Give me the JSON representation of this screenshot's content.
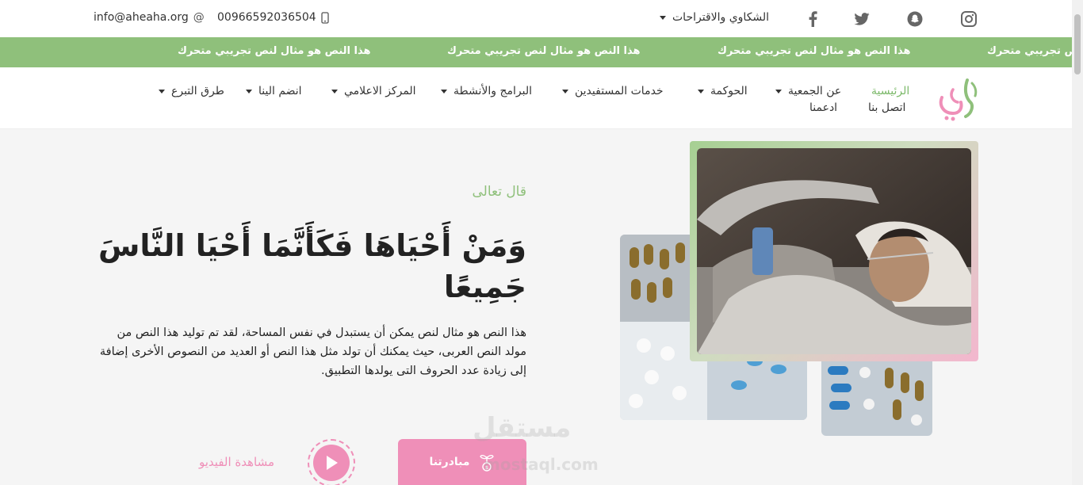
{
  "topbar": {
    "email": "info@aheaha.org",
    "phone": "00966592036504",
    "complaints": "الشكاوي والاقتراحات"
  },
  "marquee": {
    "items": [
      "هذا النص هو مثال لنص تجريبي متحرك",
      "هذا النص هو مثال لنص تجريبي متحرك",
      "هذا النص هو مثال لنص تجريبي متحرك",
      "هذا النص هو مثال لنص تجريبي متحرك"
    ],
    "partial": "ص تجريبي متحرك"
  },
  "nav": {
    "home": "الرئيسية",
    "about": "عن الجمعية",
    "governance": "الحوكمة",
    "beneficiaries": "خدمات المستفيدين",
    "programs": "البرامج والأنشطة",
    "media": "المركز الاعلامي",
    "join": "انضم الينا",
    "donate": "طرق التبرع",
    "contact": "اتصل بنا",
    "support": "ادعمنا"
  },
  "hero": {
    "subtitle": "قال تعالى",
    "title": "وَمَنْ أَحْيَاهَا فَكَأَنَّمَا أَحْيَا النَّاسَ جَمِيعًا",
    "description": "هذا النص هو مثال لنص يمكن أن يستبدل في نفس المساحة، لقد تم توليد هذا النص من مولد النص العربى، حيث يمكنك أن تولد مثل هذا النص أو العديد من النصوص الأخرى إضافة إلى زيادة عدد الحروف التى يولدها التطبيق.",
    "primary_button": "مبادرتنا",
    "video_label": "مشاهدة الفيديو"
  },
  "watermark": {
    "line1": "مستقل",
    "line2": "mostaql.com"
  },
  "colors": {
    "green": "#8fc07b",
    "pink": "#ef8fb8"
  }
}
